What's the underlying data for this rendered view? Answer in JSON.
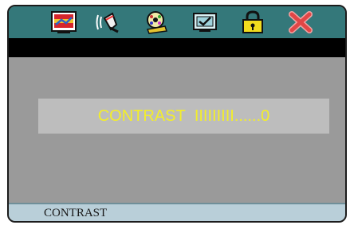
{
  "menu": {
    "icons": [
      "picture-icon",
      "sound-icon",
      "film-reel-icon",
      "checkbox-icon",
      "lock-icon",
      "close-icon"
    ]
  },
  "adjust": {
    "label": "CONTRAST",
    "bar": "IIIIIIIII......",
    "value": "0"
  },
  "status": {
    "label": "CONTRAST"
  },
  "colors": {
    "menubar": "#34787a",
    "screen": "#9a9a9a",
    "adjust_text": "#f3ee2a",
    "statusbar": "#b9cfd9"
  }
}
